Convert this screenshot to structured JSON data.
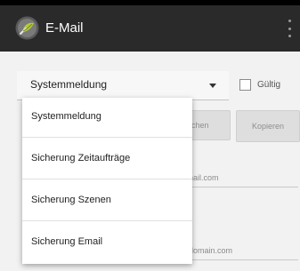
{
  "app_bar": {
    "title": "E-Mail",
    "icon": "app-logo-icon",
    "overflow_icon": "overflow-menu-icon"
  },
  "form": {
    "type_spinner": {
      "value": "Systemmeldung"
    },
    "valid_checkbox": {
      "label": "Gültig",
      "checked": false
    },
    "buttons": {
      "search_label": "chen",
      "copy_label": "Kopieren"
    },
    "address_field_1": {
      "value": "nail.com"
    },
    "address_field_2": {
      "value": "domain.com"
    }
  },
  "dropdown": {
    "items": [
      {
        "label": "Systemmeldung"
      },
      {
        "label": "Sicherung Zeitaufträge"
      },
      {
        "label": "Sicherung Szenen"
      },
      {
        "label": "Sicherung Email"
      }
    ]
  },
  "colors": {
    "app_bar": "#2a2a2a",
    "background": "#f2f2f2",
    "dropdown_bg": "#ffffff",
    "accent_green": "#8bc34a"
  }
}
